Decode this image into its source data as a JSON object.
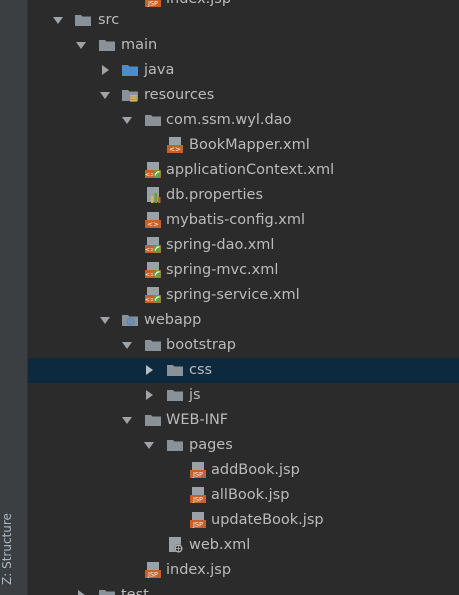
{
  "panel": {
    "structure_tab_label": "Z: Structure"
  },
  "tree": {
    "index_top": "index.jsp",
    "src": "src",
    "main": "main",
    "java": "java",
    "resources": "resources",
    "dao_package": "com.ssm.wyl.dao",
    "bookmapper": "BookMapper.xml",
    "appcontext": "applicationContext.xml",
    "dbprops": "db.properties",
    "mybatis": "mybatis-config.xml",
    "springdao": "spring-dao.xml",
    "springmvc": "spring-mvc.xml",
    "springservice": "spring-service.xml",
    "webapp": "webapp",
    "bootstrap": "bootstrap",
    "css": "css",
    "js": "js",
    "webinf": "WEB-INF",
    "pages": "pages",
    "addbook": "addBook.jsp",
    "allbook": "allBook.jsp",
    "updatebook": "updateBook.jsp",
    "webxml": "web.xml",
    "index": "index.jsp",
    "test": "test"
  },
  "icons": {
    "jsp_text": "JSP"
  },
  "colors": {
    "background": "#2b2b2b",
    "selection": "#0d293e",
    "text": "#bbbbbb",
    "folder": "#8a9299",
    "java_folder": "#4a8ccc",
    "jsp_badge": "#c8602a",
    "spring_leaf": "#6a9e3f"
  }
}
